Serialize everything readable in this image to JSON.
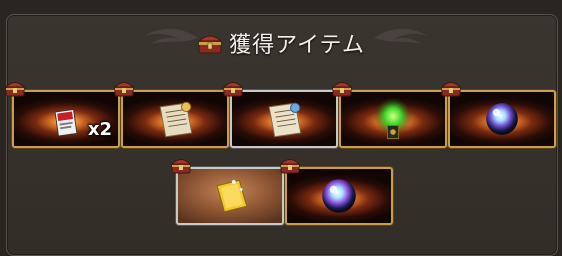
{
  "header": {
    "title": "獲得アイテム",
    "icon": "treasure-chest-icon"
  },
  "items": [
    {
      "name": "ticket-item",
      "qty": "x2",
      "frame": "gold"
    },
    {
      "name": "scroll-item",
      "qty": "",
      "frame": "gold"
    },
    {
      "name": "scroll-item",
      "qty": "",
      "frame": "silver"
    },
    {
      "name": "green-flame-item",
      "qty": "",
      "frame": "gold"
    },
    {
      "name": "crystal-orb-item",
      "qty": "",
      "frame": "gold"
    },
    {
      "name": "gold-bar-item",
      "qty": "",
      "frame": "silver"
    },
    {
      "name": "crystal-orb-item",
      "qty": "",
      "frame": "gold"
    }
  ],
  "colors": {
    "panel": "#3b3530",
    "gold_frame": "#c9a04a",
    "silver_frame": "#c9c9c9",
    "title": "#f4f0ea"
  }
}
